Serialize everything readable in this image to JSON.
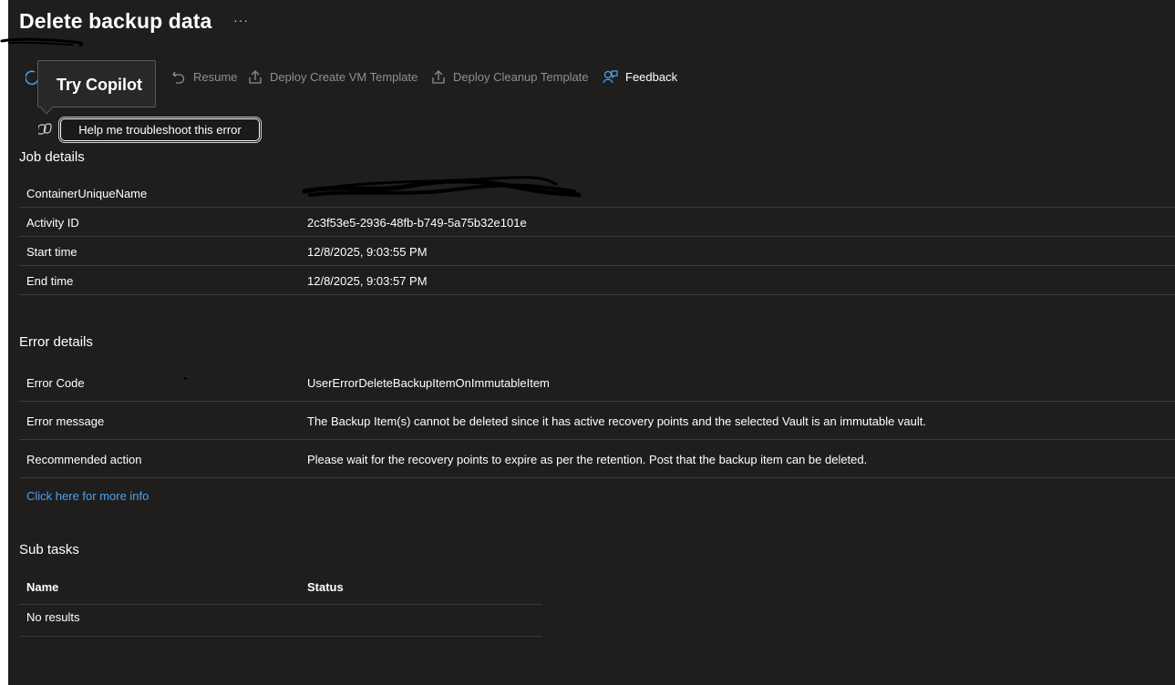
{
  "page": {
    "title": "Delete backup data",
    "more": "···"
  },
  "toolbar": {
    "items": [
      {
        "label": "Resume",
        "icon": "undo-icon",
        "enabled": false
      },
      {
        "label": "Deploy Create VM Template",
        "icon": "deploy-icon",
        "enabled": false
      },
      {
        "label": "Deploy Cleanup Template",
        "icon": "deploy-icon",
        "enabled": false
      },
      {
        "label": "Feedback",
        "icon": "feedback-icon",
        "enabled": true
      }
    ]
  },
  "tooltip": {
    "text": "Try Copilot"
  },
  "copilot": {
    "button_label": "Help me troubleshoot this error"
  },
  "job_details": {
    "title": "Job details",
    "rows": [
      {
        "key": "ContainerUniqueName",
        "value": ""
      },
      {
        "key": "Activity ID",
        "value": "2c3f53e5-2936-48fb-b749-5a75b32e101e"
      },
      {
        "key": "Start time",
        "value": "12/8/2025, 9:03:55 PM"
      },
      {
        "key": "End time",
        "value": "12/8/2025, 9:03:57 PM"
      }
    ]
  },
  "error_details": {
    "title": "Error details",
    "rows": [
      {
        "key": "Error Code",
        "value": "UserErrorDeleteBackupItemOnImmutableItem"
      },
      {
        "key": "Error message",
        "value": "The Backup Item(s) cannot be deleted since it has active recovery points and the selected Vault is an immutable vault."
      },
      {
        "key": "Recommended action",
        "value": "Please wait for the recovery points to expire as per the retention. Post that the backup item can be deleted."
      }
    ],
    "more_info_link": "Click here for more info"
  },
  "sub_tasks": {
    "title": "Sub tasks",
    "columns": [
      "Name",
      "Status"
    ],
    "empty_text": "No results"
  },
  "colors": {
    "background": "#1f1e1d",
    "link": "#4aa2f3",
    "disabled_text": "#8f8f8f",
    "divider": "#3b3a39"
  }
}
